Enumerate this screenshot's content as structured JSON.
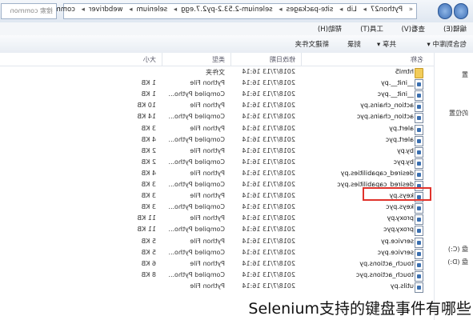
{
  "address_bar": {
    "crumbs": [
      "Python27",
      "Lib",
      "site-packages",
      "selenium-2.53.2-py2.7.egg",
      "selenium",
      "webdriver",
      "common"
    ],
    "search_placeholder": "搜索 common"
  },
  "menu": {
    "items": [
      "编辑(E)",
      "查看(V)",
      "工具(T)",
      "帮助(H)"
    ]
  },
  "toolbar": {
    "items": [
      "包含到库中 ▾",
      "共享 ▾",
      "刻录",
      "新建文件夹"
    ]
  },
  "columns": {
    "name": "名称",
    "date": "修改日期",
    "type": "类型",
    "size": "大小"
  },
  "files": [
    {
      "name": "html5",
      "date": "2018/7/13 16:14",
      "type": "文件夹",
      "size": "",
      "icon": "folder-icon"
    },
    {
      "name": "__init__.py",
      "date": "2018/7/13 16:14",
      "type": "Python File",
      "size": "1 KB",
      "icon": "python-file-icon"
    },
    {
      "name": "__init__.pyc",
      "date": "2018/7/13 16:14",
      "type": "Compiled Pytho...",
      "size": "1 KB",
      "icon": "python-file-icon"
    },
    {
      "name": "action_chains.py",
      "date": "2018/7/13 16:14",
      "type": "Python File",
      "size": "10 KB",
      "icon": "python-file-icon"
    },
    {
      "name": "action_chains.pyc",
      "date": "2018/7/13 16:14",
      "type": "Compiled Pytho...",
      "size": "14 KB",
      "icon": "python-file-icon"
    },
    {
      "name": "alert.py",
      "date": "2018/7/13 16:14",
      "type": "Python File",
      "size": "3 KB",
      "icon": "python-file-icon"
    },
    {
      "name": "alert.pyc",
      "date": "2018/7/13 16:14",
      "type": "Compiled Pytho...",
      "size": "4 KB",
      "icon": "python-file-icon"
    },
    {
      "name": "by.py",
      "date": "2018/7/13 16:14",
      "type": "Python File",
      "size": "2 KB",
      "icon": "python-file-icon"
    },
    {
      "name": "by.pyc",
      "date": "2018/7/13 16:14",
      "type": "Compiled Pytho...",
      "size": "2 KB",
      "icon": "python-file-icon"
    },
    {
      "name": "desired_capabilities.py",
      "date": "2018/7/13 16:14",
      "type": "Python File",
      "size": "4 KB",
      "icon": "python-file-icon"
    },
    {
      "name": "desired_capabilities.pyc",
      "date": "2018/7/13 16:14",
      "type": "Compiled Pytho...",
      "size": "3 KB",
      "icon": "python-file-icon"
    },
    {
      "name": "keys.py",
      "date": "2018/7/13 16:14",
      "type": "Python File",
      "size": "3 KB",
      "icon": "python-file-icon"
    },
    {
      "name": "keys.pyc",
      "date": "2018/7/13 16:14",
      "type": "Compiled Pytho...",
      "size": "3 KB",
      "icon": "python-file-icon"
    },
    {
      "name": "proxy.py",
      "date": "2018/7/13 16:14",
      "type": "Python File",
      "size": "11 KB",
      "icon": "python-file-icon"
    },
    {
      "name": "proxy.pyc",
      "date": "2018/7/13 16:14",
      "type": "Compiled Pytho...",
      "size": "11 KB",
      "icon": "python-file-icon"
    },
    {
      "name": "service.py",
      "date": "2018/7/13 16:14",
      "type": "Python File",
      "size": "5 KB",
      "icon": "python-file-icon"
    },
    {
      "name": "service.pyc",
      "date": "2018/7/13 16:14",
      "type": "Compiled Pytho...",
      "size": "5 KB",
      "icon": "python-file-icon"
    },
    {
      "name": "touch_actions.py",
      "date": "2018/7/13 16:14",
      "type": "Python File",
      "size": "6 KB",
      "icon": "python-file-icon"
    },
    {
      "name": "touch_actions.pyc",
      "date": "2018/7/13 16:14",
      "type": "Compiled Pytho...",
      "size": "8 KB",
      "icon": "python-file-icon"
    },
    {
      "name": "utils.py",
      "date": "2018/7/13 16:14",
      "type": "Python File",
      "size": "",
      "icon": "python-file-icon"
    }
  ],
  "sidebar": {
    "items": [
      "置",
      "的位置",
      "盘 (C:)",
      "盘 (D:)"
    ]
  },
  "caption": "Selenium支持的键盘事件有哪些",
  "colors": {
    "highlight": "#e0332c"
  }
}
